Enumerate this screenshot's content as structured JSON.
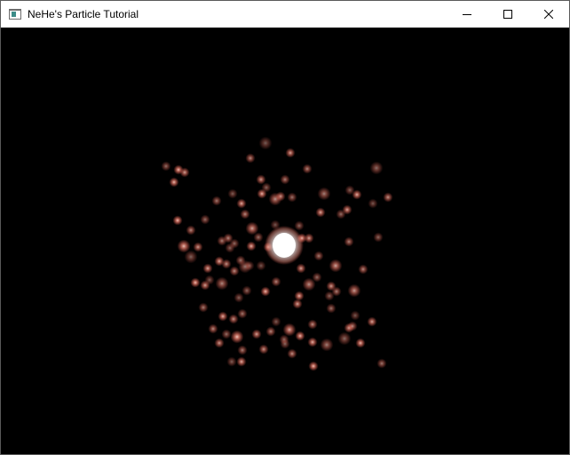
{
  "window": {
    "title": "NeHe's Particle Tutorial",
    "icons": {
      "app": "application-window-icon",
      "minimize": "minimize-icon",
      "maximize": "maximize-icon",
      "close": "close-icon"
    }
  },
  "scene": {
    "background_color": "#000000",
    "particle_color": "#ff8070",
    "core_color": "#ffffff",
    "particle_count": 120
  }
}
